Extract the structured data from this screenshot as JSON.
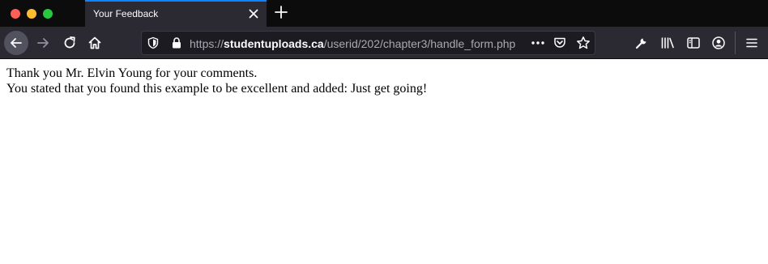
{
  "window": {
    "tab_title": "Your Feedback",
    "tab_active_color": "#0a84ff"
  },
  "toolbar": {
    "url_scheme": "https://",
    "url_host": "studentuploads.ca",
    "url_path": "/userid/202/chapter3/handle_form.php",
    "icons": [
      "back-arrow-icon",
      "forward-arrow-icon",
      "reload-icon",
      "home-icon",
      "shield-icon",
      "lock-icon",
      "more-icon",
      "pocket-icon",
      "bookmark-star-icon",
      "wrench-icon",
      "library-icon",
      "sidebar-icon",
      "account-icon",
      "menu-icon"
    ]
  },
  "page": {
    "line1": "Thank you Mr. Elvin Young for your comments.",
    "line2": "You stated that you found this example to be excellent and added: Just get going!"
  }
}
